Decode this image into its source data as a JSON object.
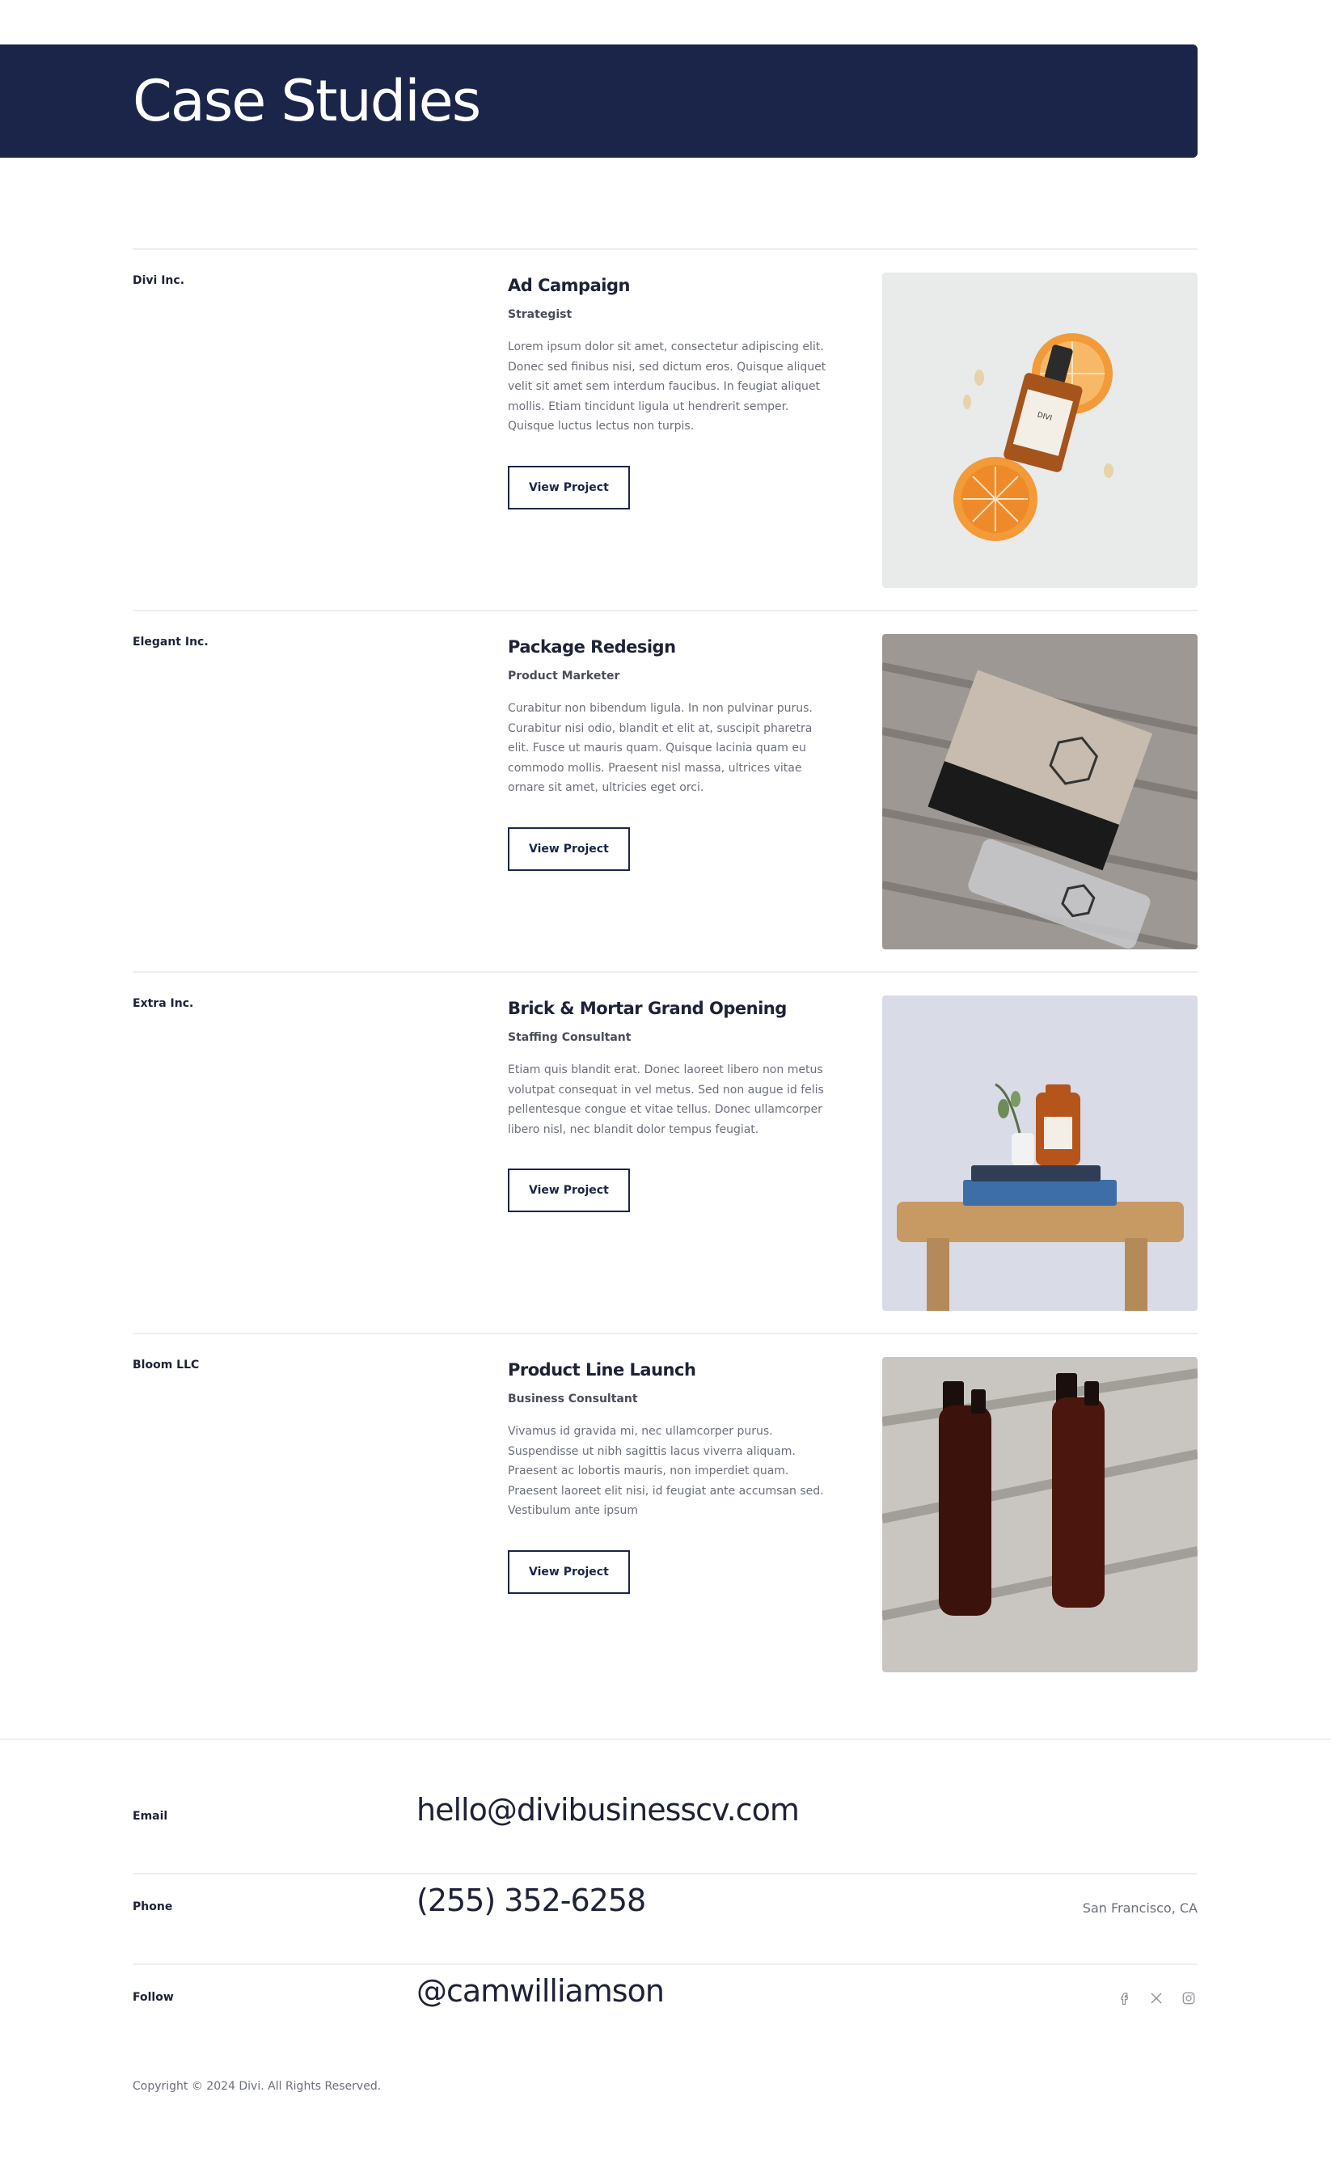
{
  "header": {
    "title": "Case Studies"
  },
  "cases": [
    {
      "client": "Divi Inc.",
      "title": "Ad Campaign",
      "role": "Strategist",
      "description": "Lorem ipsum dolor sit amet, consectetur adipiscing elit. Donec sed finibus nisi, sed dictum eros. Quisque aliquet velit sit amet sem interdum faucibus. In feugiat aliquet mollis. Etiam tincidunt ligula ut hendrerit semper. Quisque luctus lectus non turpis.",
      "button": "View Project",
      "image_label": "DIVI"
    },
    {
      "client": "Elegant Inc.",
      "title": "Package Redesign",
      "role": "Product Marketer",
      "description": "Curabitur non bibendum ligula. In non pulvinar purus. Curabitur nisi odio, blandit et elit at, suscipit pharetra elit. Fusce ut mauris quam. Quisque lacinia quam eu commodo mollis. Praesent nisl massa, ultrices vitae ornare sit amet, ultricies eget orci.",
      "button": "View Project"
    },
    {
      "client": "Extra Inc.",
      "title": "Brick & Mortar Grand Opening",
      "role": "Staffing Consultant",
      "description": "Etiam quis blandit erat. Donec laoreet libero non metus volutpat consequat in vel metus. Sed non augue id felis pellentesque congue et vitae tellus. Donec ullamcorper libero nisl, nec blandit dolor tempus feugiat.",
      "button": "View Project"
    },
    {
      "client": "Bloom LLC",
      "title": "Product Line Launch",
      "role": "Business Consultant",
      "description": "Vivamus id gravida mi, nec ullamcorper purus. Suspendisse ut nibh sagittis lacus viverra aliquam. Praesent ac lobortis mauris, non imperdiet quam. Praesent laoreet elit nisi, id feugiat ante accumsan sed. Vestibulum ante ipsum",
      "button": "View Project"
    }
  ],
  "contact": {
    "email_label": "Email",
    "email": "hello@divibusinesscv.com",
    "phone_label": "Phone",
    "phone": "(255) 352-6258",
    "location": "San Francisco, CA",
    "follow_label": "Follow",
    "handle": "@camwilliamson",
    "social_icons": [
      "facebook-icon",
      "x-icon",
      "instagram-icon"
    ]
  },
  "footer": {
    "copyright": "Copyright © 2024 Divi. All Rights Reserved."
  },
  "colors": {
    "navy": "#1b2549",
    "text": "#1e2235",
    "muted": "#6b6f7a",
    "divider": "#eceef1"
  }
}
